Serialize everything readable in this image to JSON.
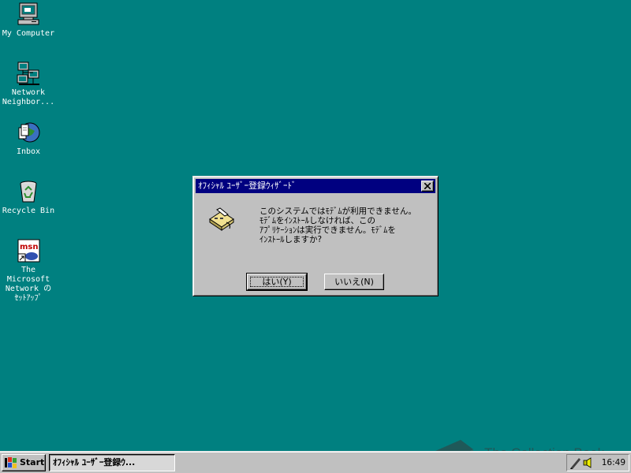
{
  "desktop": {
    "background": "#008080",
    "icons": [
      {
        "label": "My Computer",
        "icon": "my-computer-icon"
      },
      {
        "label": "Network\nNeighbor...",
        "icon": "network-neighborhood-icon"
      },
      {
        "label": "Inbox",
        "icon": "inbox-icon"
      },
      {
        "label": "Recycle Bin",
        "icon": "recycle-bin-icon"
      },
      {
        "label": "The\nMicrosoft\nNetwork の\nｾｯﾄｱｯﾌﾟ",
        "icon": "msn-setup-icon"
      }
    ]
  },
  "dialog": {
    "title": "ｵﾌｨｼｬﾙ ﾕｰｻﾞｰ登録ｳｨｻﾞｰﾄﾞ",
    "icon": "modem-phone-icon",
    "message": "このシステムではﾓﾃﾞﾑが利用できません。\nﾓﾃﾞﾑをｲﾝｽﾄｰﾙしなければ、この\nｱﾌﾟﾘｹｰｼｮﾝは実行できません。ﾓﾃﾞﾑを\nｲﾝｽﾄｰﾙしますか?",
    "yes_label": "はい(Y)",
    "no_label": "いいえ(N)",
    "close_icon": "close-icon"
  },
  "taskbar": {
    "start_label": "Start",
    "active_task": "ｵﾌｨｼｬﾙ ﾕｰｻﾞｰ登録ｳ...",
    "clock": "16:49",
    "tray_icons": [
      "pen-icon",
      "speaker-icon"
    ]
  },
  "watermark": {
    "text": "The Collection Book"
  }
}
